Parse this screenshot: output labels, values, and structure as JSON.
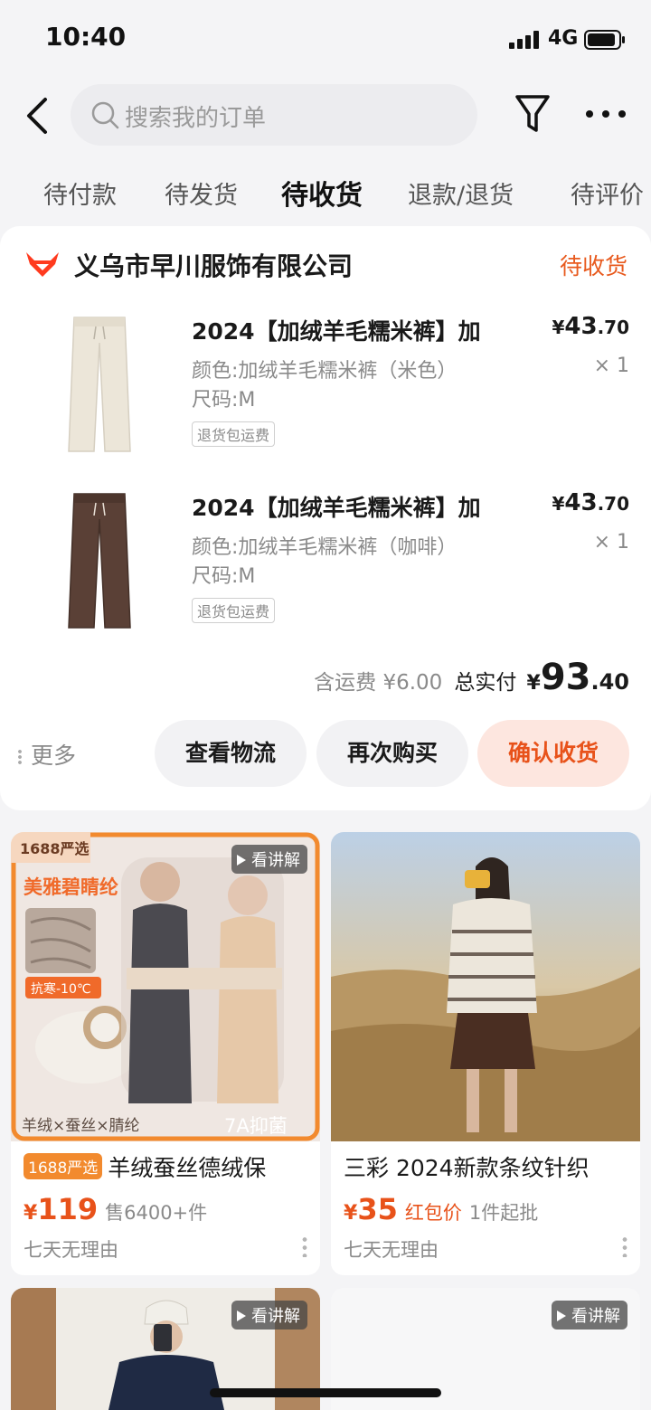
{
  "status_bar": {
    "time": "10:40",
    "network": "4G"
  },
  "header": {
    "search_placeholder": "搜索我的订单"
  },
  "tabs": [
    {
      "label": "待付款",
      "active": false
    },
    {
      "label": "待发货",
      "active": false
    },
    {
      "label": "待收货",
      "active": true
    },
    {
      "label": "退款/退货",
      "active": false
    },
    {
      "label": "待评价",
      "active": false
    }
  ],
  "order": {
    "shop_name": "义乌市早川服饰有限公司",
    "status": "待收货",
    "items": [
      {
        "title": "2024【加绒羊毛糯米裤】加",
        "spec": "颜色:加绒羊毛糯米裤（米色）",
        "size": "尺码:M",
        "tag": "退货包运费",
        "price_symbol": "¥",
        "price_int": "43",
        "price_dec": ".70",
        "qty": "× 1",
        "color": "#ece6d9"
      },
      {
        "title": "2024【加绒羊毛糯米裤】加",
        "spec": "颜色:加绒羊毛糯米裤（咖啡）",
        "size": "尺码:M",
        "tag": "退货包运费",
        "price_symbol": "¥",
        "price_int": "43",
        "price_dec": ".70",
        "qty": "× 1",
        "color": "#5a4036"
      }
    ],
    "shipping_fee": "含运费 ¥6.00",
    "total_label": "总实付",
    "total_symbol": "¥",
    "total_int": "93",
    "total_dec": ".40",
    "more_label": "更多",
    "buttons": {
      "logistics": "查看物流",
      "rebuy": "再次购买",
      "confirm": "确认收货"
    }
  },
  "recommendations": [
    {
      "badge": "1688严选",
      "title": "羊绒蚕丝德绒保",
      "price_symbol": "¥",
      "price": "119",
      "sub": "售6400+件",
      "note": "七天无理由",
      "video_label": "看讲解",
      "image_texts": {
        "top_badge": "1688严选",
        "brand": "美雅碧睛纶",
        "cold": "抗寒-10℃",
        "materials": "羊绒×蚕丝×腈纶",
        "antibac": "7A抑菌"
      }
    },
    {
      "title": "三彩 2024新款条纹针织",
      "price_symbol": "¥",
      "price": "35",
      "red_packet": "红包价",
      "sub": "1件起批",
      "note": "七天无理由"
    },
    {
      "video_label": "看讲解"
    },
    {
      "video_label": "看讲解"
    }
  ]
}
